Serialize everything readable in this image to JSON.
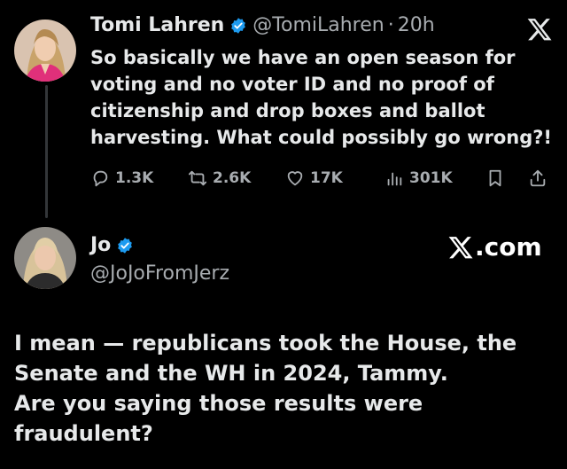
{
  "colors": {
    "background": "#000000",
    "text_primary": "#e7e9ea",
    "text_secondary": "#a8acb0",
    "verified_blue": "#1d9bf0",
    "thread_line": "#333639"
  },
  "original_tweet": {
    "author_name": "Tomi Lahren",
    "verified_icon": "verified-badge-icon",
    "handle": "@TomiLahren",
    "separator": "·",
    "time": "20h",
    "text": "So basically we have an open season for voting and no voter ID and no proof of citizenship and drop boxes and ballot harvesting. What could possibly go wrong?!",
    "close_icon": "x-logo-icon",
    "actions": {
      "reply": {
        "icon": "reply-icon",
        "count": "1.3K"
      },
      "retweet": {
        "icon": "retweet-icon",
        "count": "2.6K"
      },
      "like": {
        "icon": "heart-icon",
        "count": "17K"
      },
      "views": {
        "icon": "views-chart-icon",
        "count": "301K"
      },
      "bookmark": {
        "icon": "bookmark-icon"
      },
      "share": {
        "icon": "share-icon"
      }
    }
  },
  "reply_tweet": {
    "author_name": "Jo",
    "verified_icon": "verified-badge-icon",
    "handle": "@JoJoFromJerz",
    "brand": ".com",
    "brand_icon": "x-logo-icon",
    "text_lines": [
      "I mean — republicans took the House, the",
      "Senate and the WH in 2024, Tammy.",
      "Are you saying those results were",
      "fraudulent?"
    ]
  }
}
